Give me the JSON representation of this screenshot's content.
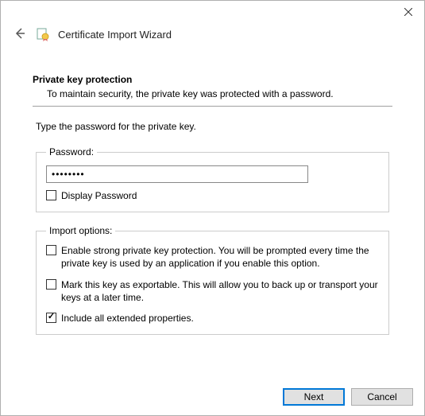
{
  "window": {
    "title": "Certificate Import Wizard"
  },
  "page": {
    "heading": "Private key protection",
    "subheading": "To maintain security, the private key was protected with a password.",
    "instruction": "Type the password for the private key."
  },
  "password_group": {
    "legend": "Password:",
    "value": "••••••••",
    "display_password_label": "Display Password",
    "display_password_checked": false
  },
  "import_group": {
    "legend": "Import options:",
    "options": [
      {
        "label": "Enable strong private key protection. You will be prompted every time the private key is used by an application if you enable this option.",
        "checked": false
      },
      {
        "label": "Mark this key as exportable. This will allow you to back up or transport your keys at a later time.",
        "checked": false
      },
      {
        "label": "Include all extended properties.",
        "checked": true
      }
    ]
  },
  "footer": {
    "next_label": "Next",
    "cancel_label": "Cancel"
  }
}
